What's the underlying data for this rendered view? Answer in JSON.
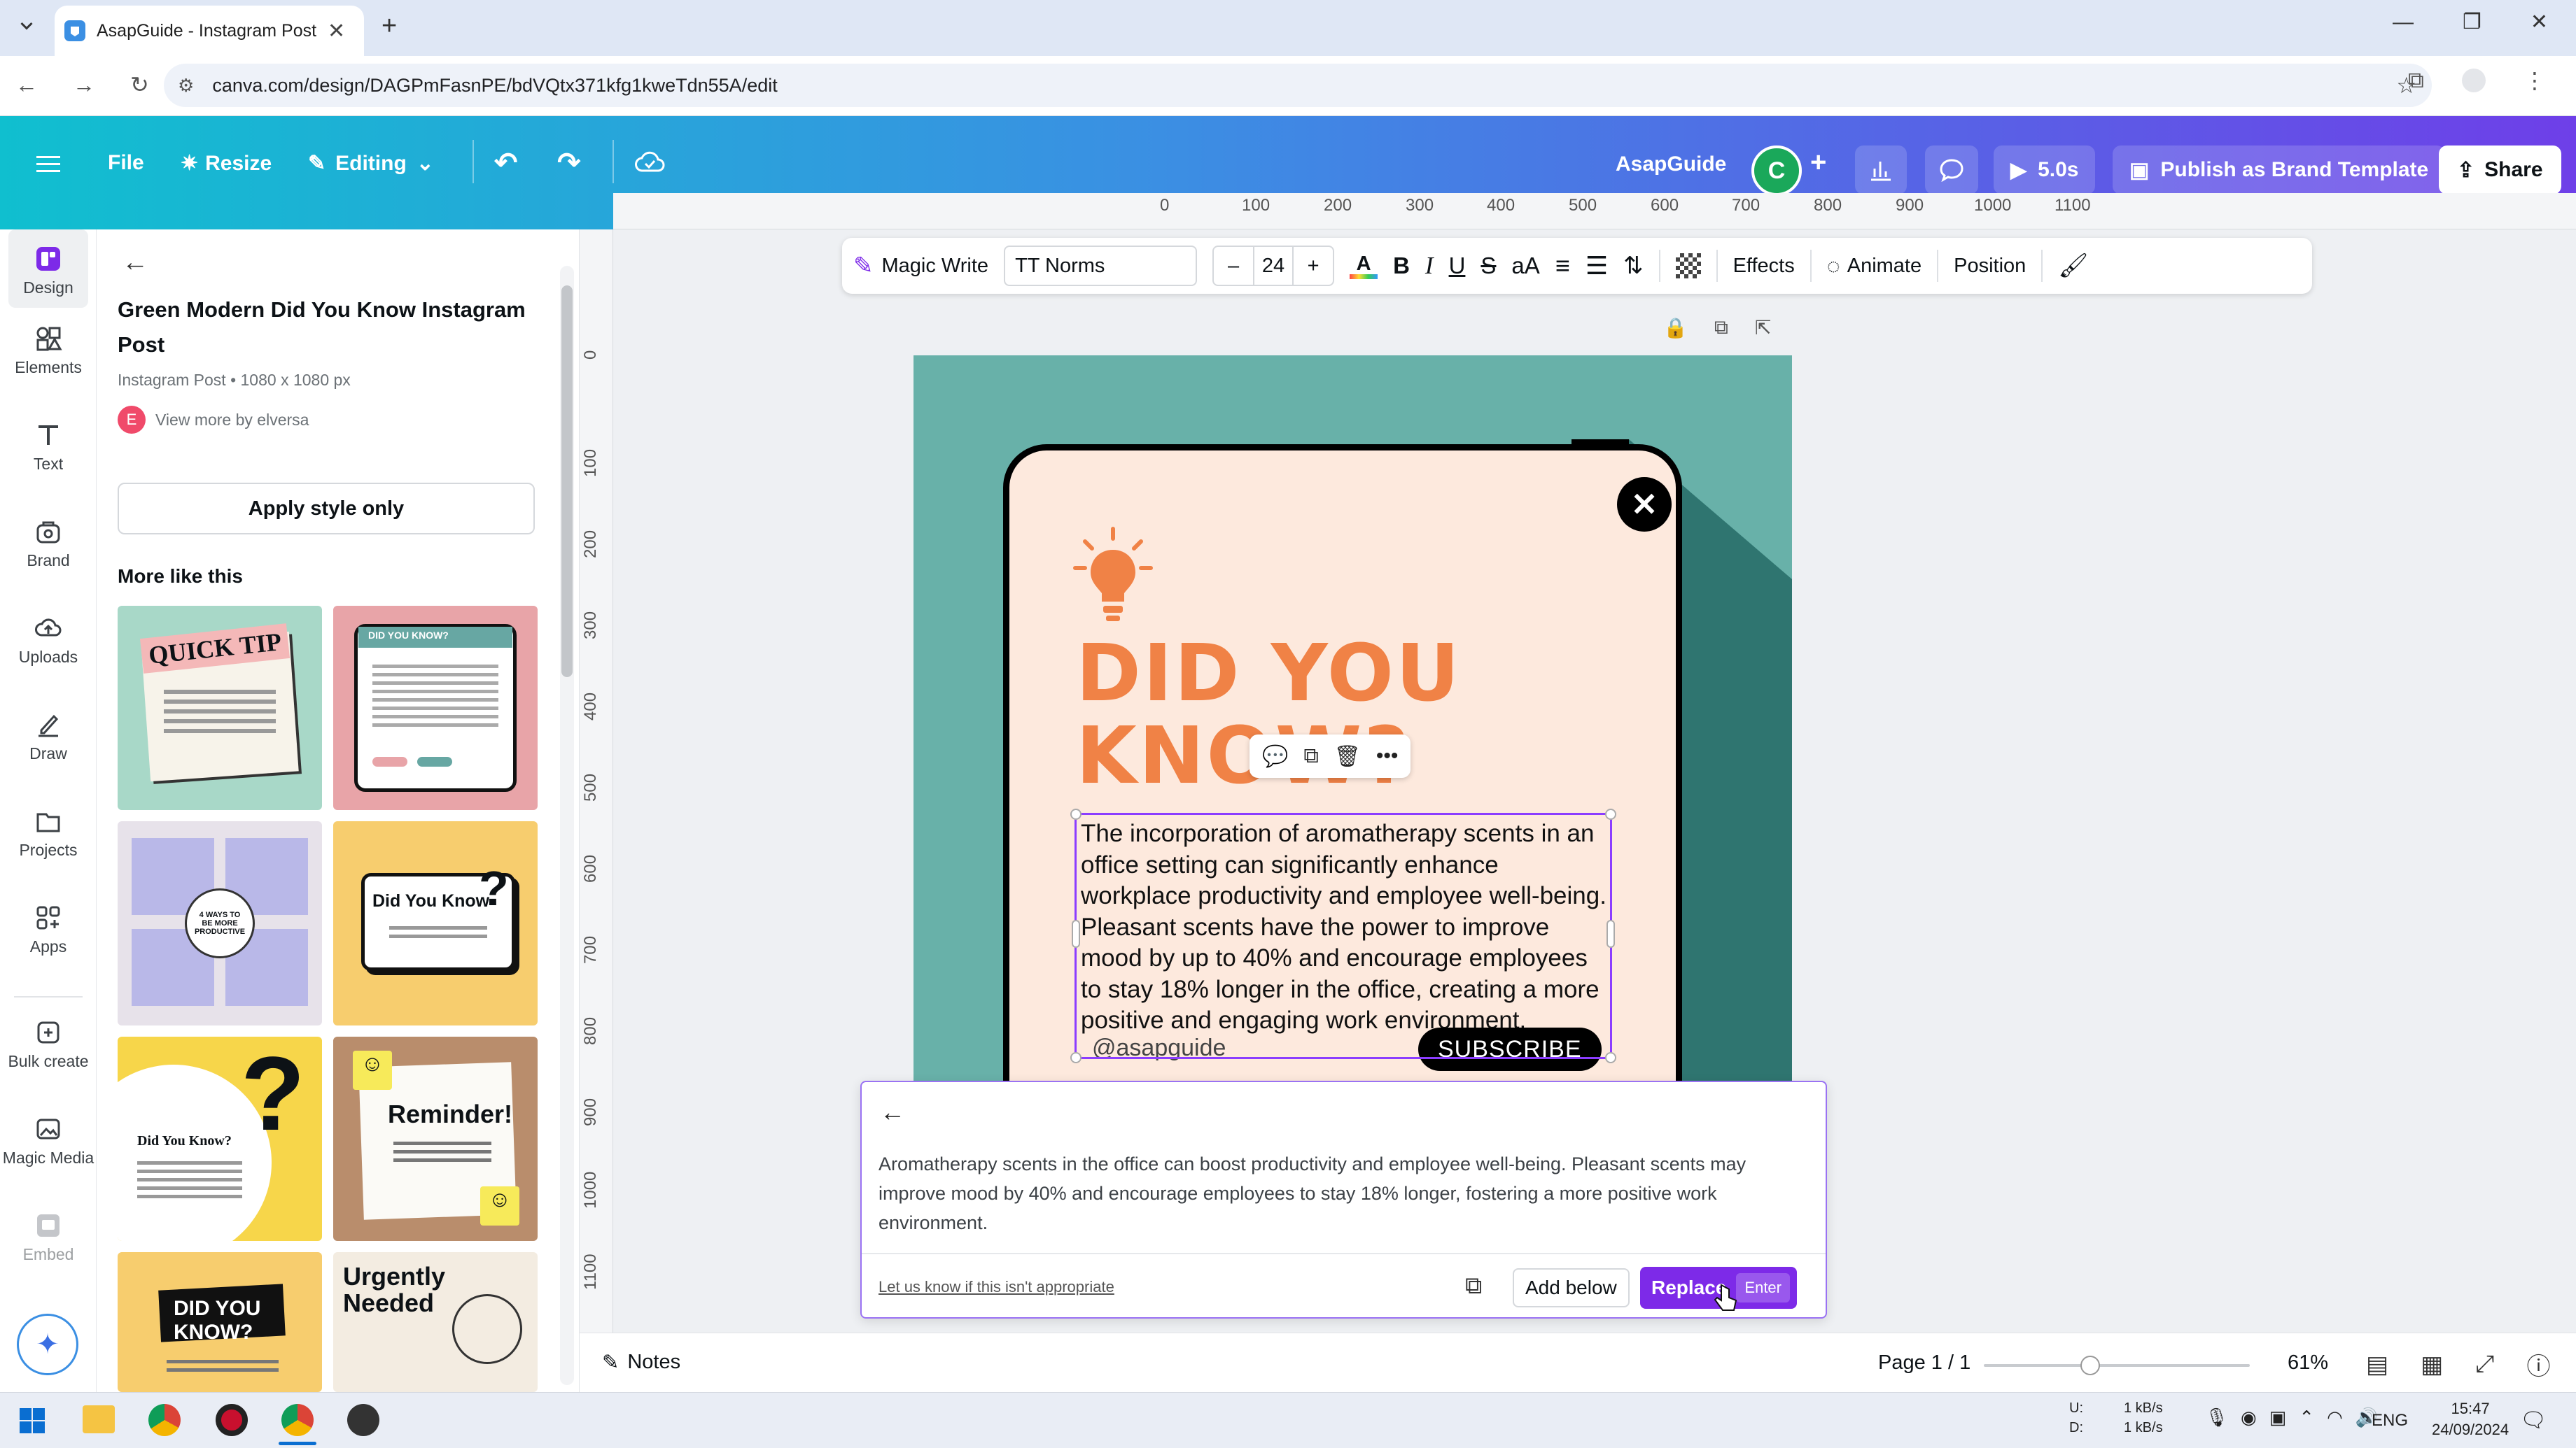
{
  "browser": {
    "tab_title": "AsapGuide - Instagram Post",
    "url": "canva.com/design/DAGPmFasnPE/bdVQtx371kfg1kweTdn55A/edit"
  },
  "header": {
    "file": "File",
    "resize": "Resize",
    "editing": "Editing",
    "project_name": "AsapGuide",
    "avatar_letter": "C",
    "timer": "5.0s",
    "publish": "Publish as Brand Template",
    "share": "Share"
  },
  "rail": {
    "items": [
      {
        "label": "Design",
        "icon": "design-icon"
      },
      {
        "label": "Elements",
        "icon": "elements-icon"
      },
      {
        "label": "Text",
        "icon": "text-icon"
      },
      {
        "label": "Brand",
        "icon": "brand-icon"
      },
      {
        "label": "Uploads",
        "icon": "uploads-icon"
      },
      {
        "label": "Draw",
        "icon": "draw-icon"
      },
      {
        "label": "Projects",
        "icon": "projects-icon"
      },
      {
        "label": "Apps",
        "icon": "apps-icon"
      },
      {
        "label": "Bulk create",
        "icon": "bulk-create-icon"
      },
      {
        "label": "Magic Media",
        "icon": "magic-media-icon"
      },
      {
        "label": "Embed",
        "icon": "embed-icon"
      }
    ]
  },
  "panel": {
    "title": "Green Modern Did You Know Instagram Post",
    "subtitle": "Instagram Post • 1080 x 1080 px",
    "author_letter": "E",
    "author_link": "View more by elversa",
    "apply_button": "Apply style only",
    "more_heading": "More like this",
    "thumbs": [
      {
        "text": "QUICK TIP",
        "bg": "#a8d8c8"
      },
      {
        "text": "DID YOU KNOW?",
        "bg": "#e8a4a8"
      },
      {
        "text": "4 WAYS TO BE MORE PRODUCTIVE",
        "bg": "#e7e2ea"
      },
      {
        "text": "Did You Know",
        "bg": "#f7cd6e"
      },
      {
        "text": "Did You Know?",
        "bg": "#f7d64a"
      },
      {
        "text": "Reminder!",
        "bg": "#b98d6c"
      },
      {
        "text": "DID YOU KNOW?",
        "bg": "#f7cd6e"
      },
      {
        "text": "Urgently Needed",
        "bg": "#f3ece1"
      }
    ]
  },
  "ruler": {
    "h": [
      "0",
      "100",
      "200",
      "300",
      "400",
      "500",
      "600",
      "700",
      "800",
      "900",
      "1000",
      "1100"
    ],
    "v": [
      "0",
      "100",
      "200",
      "300",
      "400",
      "500",
      "600",
      "700",
      "800",
      "900",
      "1000",
      "1100"
    ]
  },
  "textbar": {
    "magic_write": "Magic Write",
    "font": "TT Norms",
    "size": "24",
    "effects": "Effects",
    "animate": "Animate",
    "position": "Position"
  },
  "design": {
    "headline_1": "DID YOU",
    "headline_2": "KNOW?",
    "body": "The incorporation of aromatherapy scents in an office setting can significantly enhance workplace productivity and employee well-being. Pleasant scents have the power to improve mood by up to 40% and encourage employees to stay 18% longer in the office, creating a more positive and engaging work environment.",
    "handle": "@asapguide",
    "subscribe": "SUBSCRIBE"
  },
  "ai_panel": {
    "suggestion": "Aromatherapy scents in the office can boost productivity and employee well-being. Pleasant scents may improve mood by 40% and encourage employees to stay 18% longer, fostering a more positive work environment.",
    "feedback_link": "Let us know if this isn't appropriate",
    "add_below": "Add below",
    "replace": "Replace",
    "enter": "Enter"
  },
  "footer": {
    "notes": "Notes",
    "page": "Page 1 / 1",
    "zoom": "61%",
    "zoom_level": 0.61
  },
  "taskbar": {
    "net_up_label": "U:",
    "net_down_label": "D:",
    "net_up": "1 kB/s",
    "net_down": "1 kB/s",
    "lang": "ENG",
    "time": "15:47",
    "date": "24/09/2024"
  }
}
